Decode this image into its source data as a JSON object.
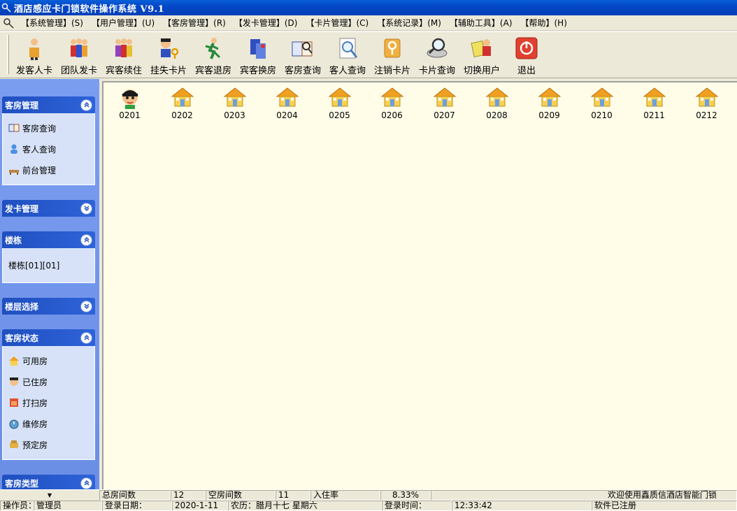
{
  "title": "酒店感应卡门锁软件操作系统 V9.1",
  "menu": [
    "【系统管理】(S)",
    "【用户管理】(U)",
    "【客房管理】(R)",
    "【发卡管理】(D)",
    "【卡片管理】(C)",
    "【系统记录】(M)",
    "【辅助工具】(A)",
    "【帮助】(H)"
  ],
  "toolbar": [
    "发客人卡",
    "团队发卡",
    "宾客续住",
    "挂失卡片",
    "宾客退房",
    "宾客换房",
    "客房查询",
    "客人查询",
    "注销卡片",
    "卡片查询",
    "切换用户",
    "退出"
  ],
  "sidebar": {
    "guest_room_mgmt": {
      "header": "客房管理",
      "items": [
        "客房查询",
        "客人查询",
        "前台管理"
      ]
    },
    "card_mgmt": {
      "header": "发卡管理"
    },
    "building": {
      "header": "楼栋",
      "text": "楼栋[01][01]"
    },
    "floor_select": {
      "header": "楼层选择"
    },
    "room_status": {
      "header": "客房状态",
      "items": [
        "可用房",
        "已住房",
        "打扫房",
        "维修房",
        "预定房"
      ]
    },
    "room_type": {
      "header": "客房类型"
    }
  },
  "rooms": [
    "0201",
    "0202",
    "0203",
    "0204",
    "0205",
    "0206",
    "0207",
    "0208",
    "0209",
    "0210",
    "0211",
    "0212"
  ],
  "status": {
    "total_label": "总房间数",
    "total_value": "12",
    "empty_label": "空房间数",
    "empty_value": "11",
    "occupancy_label": "入住率",
    "occupancy_value": "8.33%",
    "welcome": "欢迎使用鑫质信酒店智能门锁",
    "operator_label": "操作员：",
    "operator_value": "管理员",
    "login_date_label": "登录日期：",
    "login_date_value": "2020-1-11",
    "lunar": "农历：腊月十七  星期六",
    "login_time_label": "登录时间：",
    "login_time_value": "12:33:42",
    "registered": "软件已注册"
  }
}
